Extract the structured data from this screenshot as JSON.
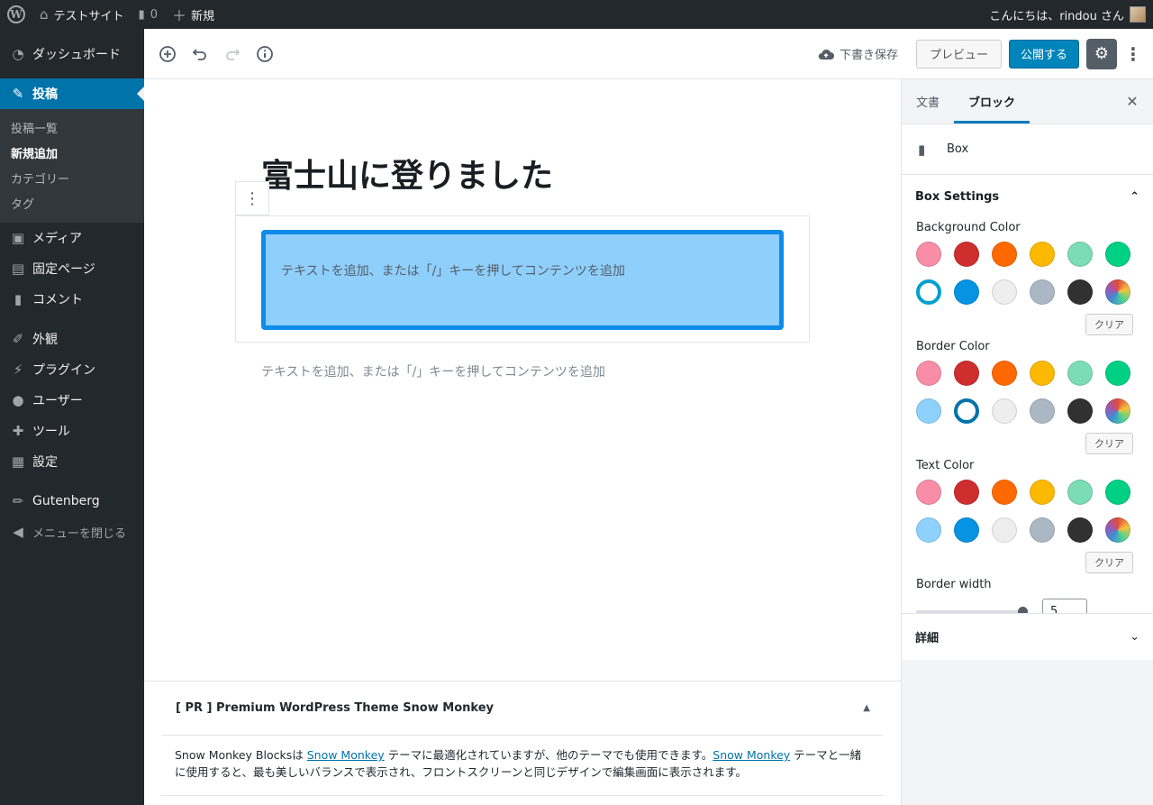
{
  "admin_bar": {
    "site_name": "テストサイト",
    "comment_count": "0",
    "new_label": "新規",
    "greeting": "こんにちは、rindou さん"
  },
  "sidebar": {
    "dashboard": "ダッシュボード",
    "posts": "投稿",
    "posts_sub": [
      "投稿一覧",
      "新規追加",
      "カテゴリー",
      "タグ"
    ],
    "media": "メディア",
    "pages": "固定ページ",
    "comments": "コメント",
    "appearance": "外観",
    "plugins": "プラグイン",
    "users": "ユーザー",
    "tools": "ツール",
    "settings": "設定",
    "gutenberg": "Gutenberg",
    "collapse": "メニューを閉じる"
  },
  "header": {
    "save_draft": "下書き保存",
    "preview": "プレビュー",
    "publish": "公開する"
  },
  "editor": {
    "title": "富士山に登りました",
    "box_placeholder": "テキストを追加、または「/」キーを押してコンテンツを追加",
    "paragraph_placeholder": "テキストを追加、または「/」キーを押してコンテンツを追加"
  },
  "pr": {
    "title": "[ PR ] Premium WordPress Theme Snow Monkey",
    "text_1": "Snow Monkey Blocksは ",
    "link_1": "Snow Monkey",
    "text_2": " テーマに最適化されていますが、他のテーマでも使用できます。",
    "link_2": "Snow Monkey",
    "text_3": " テーマと一緒に使用すると、最も美しいバランスで表示され、フロントスクリーンと同じデザインで編集画面に表示されます。"
  },
  "panel": {
    "tab_document": "文書",
    "tab_block": "ブロック",
    "block_name": "Box",
    "section_title": "Box Settings",
    "background_color_label": "Background Color",
    "border_color_label": "Border Color",
    "text_color_label": "Text Color",
    "clear_label": "クリア",
    "border_width_label": "Border width",
    "border_width_value": "5",
    "details_label": "詳細"
  },
  "palette": [
    "#f78da7",
    "#cf2e2e",
    "#ff6900",
    "#fcb900",
    "#7bdcb5",
    "#00d084",
    "#8ed1fc",
    "#0693e3",
    "#eeeeee",
    "#abb8c3",
    "#313131",
    "custom"
  ],
  "selected": {
    "background": "#8ed1fc",
    "border": "#0693e3",
    "text": null
  }
}
